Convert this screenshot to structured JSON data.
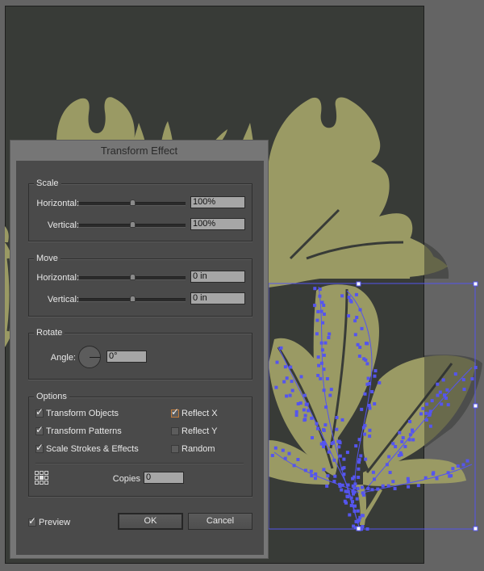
{
  "dialog": {
    "title": "Transform Effect",
    "scale": {
      "label": "Scale",
      "horizontal_label": "Horizontal:",
      "horizontal_value": "100%",
      "horizontal_slider_fraction": 0.5,
      "vertical_label": "Vertical:",
      "vertical_value": "100%",
      "vertical_slider_fraction": 0.5
    },
    "move": {
      "label": "Move",
      "horizontal_label": "Horizontal:",
      "horizontal_value": "0 in",
      "horizontal_slider_fraction": 0.5,
      "vertical_label": "Vertical:",
      "vertical_value": "0 in",
      "vertical_slider_fraction": 0.5
    },
    "rotate": {
      "label": "Rotate",
      "angle_label": "Angle:",
      "angle_value": "0°"
    },
    "options": {
      "label": "Options",
      "transform_objects": {
        "label": "Transform Objects",
        "checked": true
      },
      "transform_patterns": {
        "label": "Transform Patterns",
        "checked": true
      },
      "scale_strokes": {
        "label": "Scale Strokes & Effects",
        "checked": true
      },
      "reflect_x": {
        "label": "Reflect X",
        "checked": true
      },
      "reflect_y": {
        "label": "Reflect Y",
        "checked": false
      },
      "random": {
        "label": "Random",
        "checked": false
      },
      "copies_label": "Copies",
      "copies_value": "0",
      "reference_point_icon": "reference-point-grid-icon"
    },
    "preview": {
      "label": "Preview",
      "checked": true
    },
    "ok_label": "OK",
    "cancel_label": "Cancel",
    "check_glyph": "✓"
  },
  "canvas": {
    "background_color": "#383b37",
    "artwork_color": "#9a9a64",
    "selection_color": "#5555ee"
  }
}
